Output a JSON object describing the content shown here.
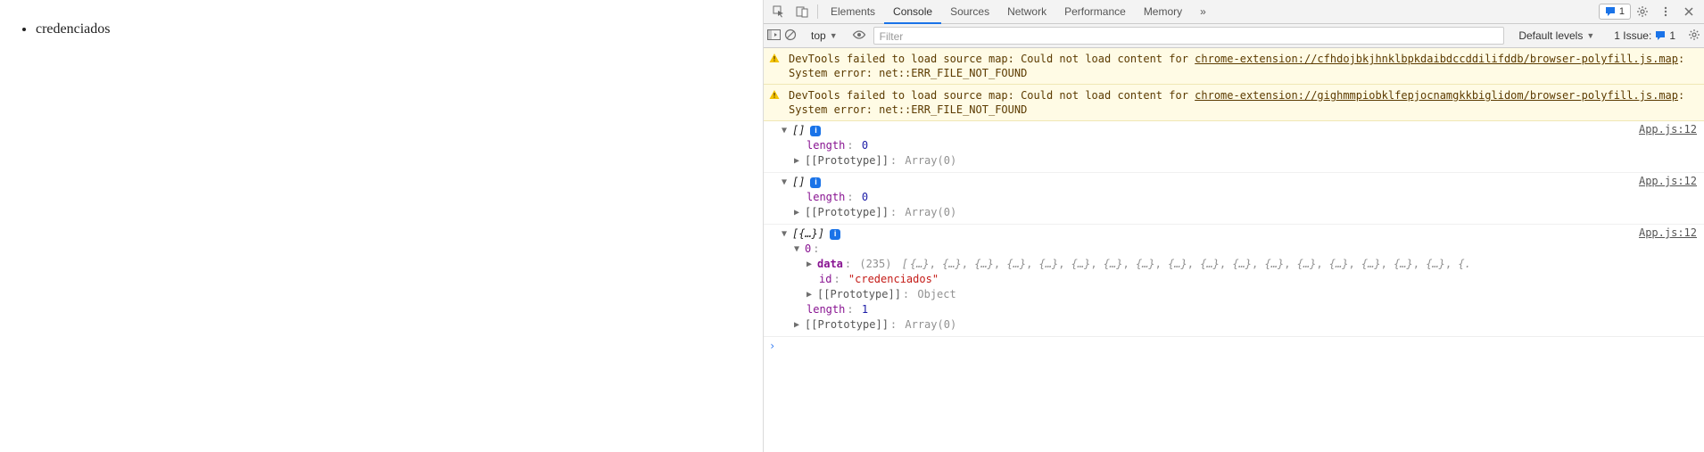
{
  "page": {
    "list_item": "credenciados"
  },
  "devtools": {
    "tabs": [
      "Elements",
      "Console",
      "Sources",
      "Network",
      "Performance",
      "Memory"
    ],
    "active_tab": "Console",
    "more_glyph": "»",
    "top_badge_count": "1",
    "toolbar": {
      "context_label": "top",
      "filter_placeholder": "Filter",
      "levels_label": "Default levels",
      "issues_label": "1 Issue:",
      "issues_count": "1"
    },
    "warnings": [
      {
        "prefix": "DevTools failed to load source map: Could not load content for ",
        "url": "chrome-extension://cfhdojbkjhnklbpkdaibdccddilifddb/browser-polyfill.js.map",
        "suffix": ": System error: net::ERR_FILE_NOT_FOUND"
      },
      {
        "prefix": "DevTools failed to load source map: Could not load content for ",
        "url": "chrome-extension://gighmmpiobklfepjocnamgkkbiglidom/browser-polyfill.js.map",
        "suffix": ": System error: net::ERR_FILE_NOT_FOUND"
      }
    ],
    "logs": [
      {
        "src": "App.js:12",
        "head": "[]",
        "length_key": "length",
        "length_val": "0",
        "proto_label": "[[Prototype]]",
        "proto_val": "Array(0)"
      },
      {
        "src": "App.js:12",
        "head": "[]",
        "length_key": "length",
        "length_val": "0",
        "proto_label": "[[Prototype]]",
        "proto_val": "Array(0)"
      }
    ],
    "log_obj": {
      "src": "App.js:12",
      "head": "[{…}]",
      "idx_key": "0",
      "data_key": "data",
      "data_count": "(235)",
      "data_bracket_open": "[",
      "data_token": "{…}",
      "id_key": "id",
      "id_val": "\"credenciados\"",
      "inner_proto_label": "[[Prototype]]",
      "inner_proto_val": "Object",
      "length_key": "length",
      "length_val": "1",
      "outer_proto_label": "[[Prototype]]",
      "outer_proto_val": "Array(0)"
    },
    "data_repeat_count": 17
  }
}
